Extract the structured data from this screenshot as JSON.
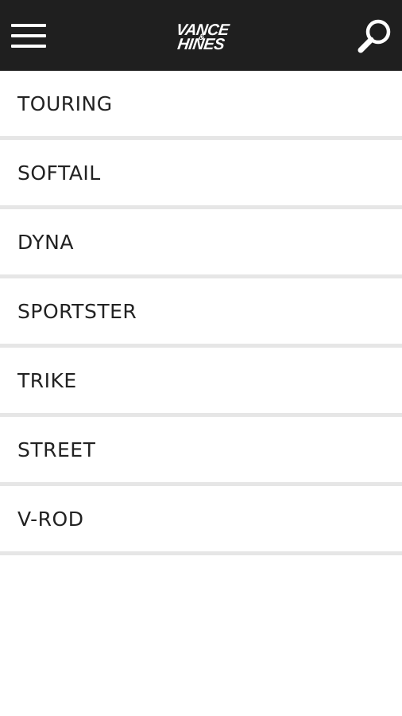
{
  "header": {
    "logo_top": "VANCE",
    "logo_amp": "&",
    "logo_bottom": "HINES",
    "background_color": "#1f1f1f",
    "menu_icon": "hamburger-menu-icon",
    "search_icon": "search-icon"
  },
  "categories": [
    {
      "label": "TOURING"
    },
    {
      "label": "SOFTAIL"
    },
    {
      "label": "DYNA"
    },
    {
      "label": "SPORTSTER"
    },
    {
      "label": "TRIKE"
    },
    {
      "label": "STREET"
    },
    {
      "label": "V-ROD"
    }
  ]
}
